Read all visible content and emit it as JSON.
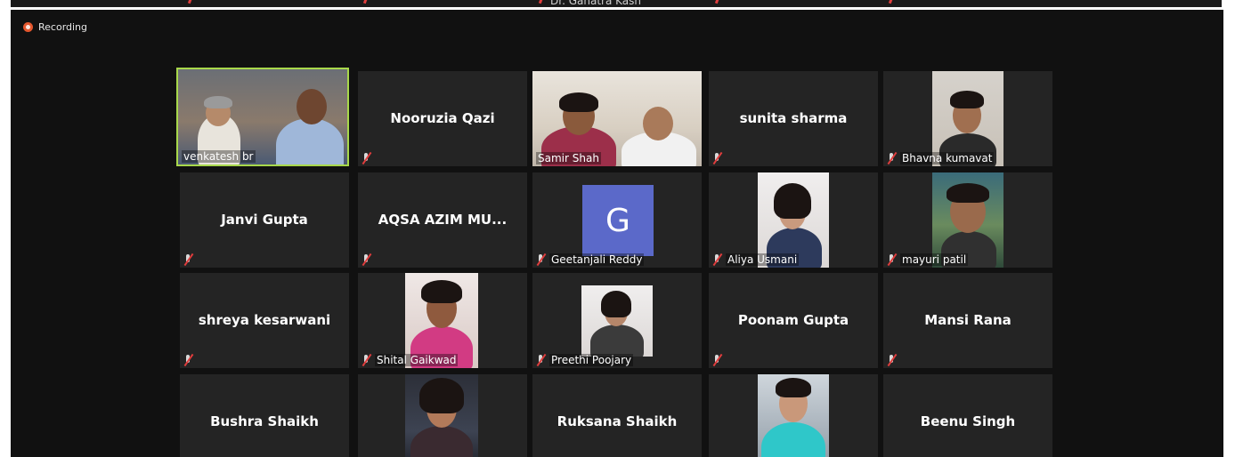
{
  "recording": {
    "label": "Recording"
  },
  "top_strip": {
    "partial_name": "Dr. Ganatra Kash"
  },
  "participants": [
    {
      "name": "venkatesh br",
      "video": true,
      "active_speaker": true,
      "muted": false
    },
    {
      "name": "Nooruzia Qazi",
      "video": false,
      "muted": true
    },
    {
      "name": "Samir Shah",
      "video": true,
      "muted": false
    },
    {
      "name": "sunita sharma",
      "video": false,
      "muted": true
    },
    {
      "name": "Bhavna kumavat",
      "video": true,
      "muted": true
    },
    {
      "name": "Janvi Gupta",
      "video": false,
      "muted": true
    },
    {
      "name": "AQSA AZIM MU...",
      "video": false,
      "muted": true
    },
    {
      "name": "Geetanjali Reddy",
      "video": false,
      "avatar_letter": "G",
      "avatar_color": "#5b69c9",
      "muted": true
    },
    {
      "name": "Aliya Usmani",
      "video": true,
      "muted": true
    },
    {
      "name": "mayuri patil",
      "video": true,
      "muted": true
    },
    {
      "name": "shreya kesarwani",
      "video": false,
      "muted": true
    },
    {
      "name": "Shital Gaikwad",
      "video": true,
      "muted": true
    },
    {
      "name": "Preethi Poojary",
      "video": true,
      "muted": true
    },
    {
      "name": "Poonam Gupta",
      "video": false,
      "muted": true
    },
    {
      "name": "Mansi Rana",
      "video": false,
      "muted": true
    },
    {
      "name": "Bushra Shaikh",
      "video": false,
      "muted": true
    },
    {
      "name": "",
      "video": true,
      "muted": true
    },
    {
      "name": "Ruksana Shaikh",
      "video": false,
      "muted": true
    },
    {
      "name": "",
      "video": true,
      "muted": true
    },
    {
      "name": "Beenu Singh",
      "video": false,
      "muted": true
    }
  ],
  "colors": {
    "background": "#111111",
    "tile": "#242424",
    "active_border": "#a8d84b",
    "muted_red": "#e03d3d",
    "recording_dot": "#e4572e"
  }
}
